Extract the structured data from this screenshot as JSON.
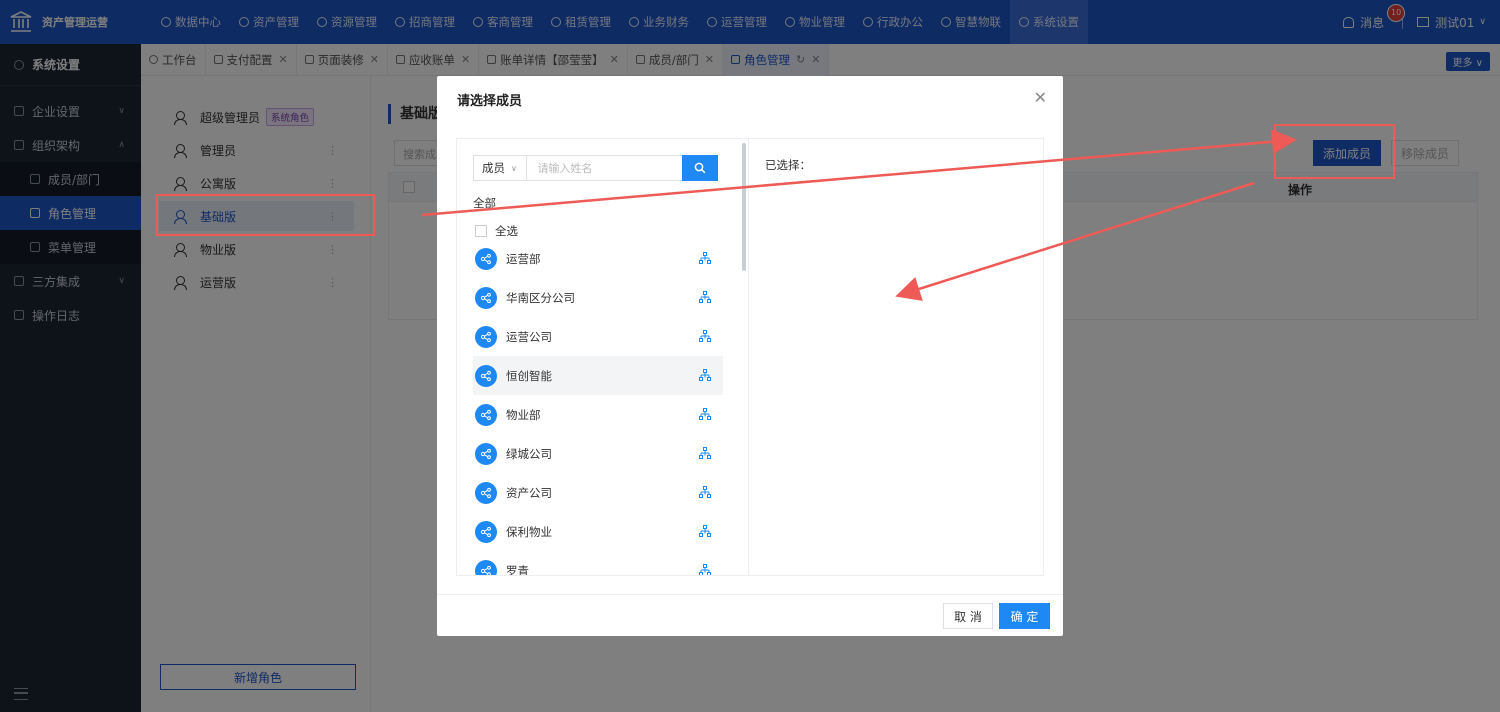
{
  "brand": {
    "name": "资产管理运营"
  },
  "nav": [
    {
      "label": "数据中心"
    },
    {
      "label": "资产管理"
    },
    {
      "label": "资源管理"
    },
    {
      "label": "招商管理"
    },
    {
      "label": "客商管理"
    },
    {
      "label": "租赁管理"
    },
    {
      "label": "业务财务"
    },
    {
      "label": "运营管理"
    },
    {
      "label": "物业管理"
    },
    {
      "label": "行政办公"
    },
    {
      "label": "智慧物联"
    },
    {
      "label": "系统设置"
    }
  ],
  "topright": {
    "messages_label": "消息",
    "messages_count": "10",
    "user": "测试01"
  },
  "sidebar": {
    "title": "系统设置",
    "items": [
      {
        "label": "企业设置"
      },
      {
        "label": "组织架构"
      },
      {
        "label": "成员/部门"
      },
      {
        "label": "角色管理"
      },
      {
        "label": "菜单管理"
      },
      {
        "label": "三方集成"
      },
      {
        "label": "操作日志"
      }
    ]
  },
  "tabs": [
    {
      "label": "工作台"
    },
    {
      "label": "支付配置"
    },
    {
      "label": "页面装修"
    },
    {
      "label": "应收账单"
    },
    {
      "label": "账单详情【邵莹莹】"
    },
    {
      "label": "成员/部门"
    },
    {
      "label": "角色管理"
    }
  ],
  "more_label": "更多",
  "roles": [
    {
      "label": "超级管理员",
      "tag": "系统角色"
    },
    {
      "label": "管理员"
    },
    {
      "label": "公寓版"
    },
    {
      "label": "基础版"
    },
    {
      "label": "物业版"
    },
    {
      "label": "运营版"
    }
  ],
  "add_role_label": "新增角色",
  "content": {
    "title": "基础版",
    "search_placeholder": "搜索成",
    "op_header": "操作",
    "add_member": "添加成员",
    "remove_member": "移除成员"
  },
  "modal": {
    "title": "请选择成员",
    "select_label": "成员",
    "search_placeholder": "请输入姓名",
    "all_label": "全部",
    "select_all": "全选",
    "departments": [
      {
        "label": "运营部"
      },
      {
        "label": "华南区分公司"
      },
      {
        "label": "运营公司"
      },
      {
        "label": "恒创智能"
      },
      {
        "label": "物业部"
      },
      {
        "label": "绿城公司"
      },
      {
        "label": "资产公司"
      },
      {
        "label": "保利物业"
      },
      {
        "label": "罗青"
      }
    ],
    "selected_label": "已选择：",
    "cancel": "取 消",
    "ok": "确 定"
  },
  "colors": {
    "primary": "#1f56c8",
    "accent": "#1e88f5",
    "annotation": "#ee5b57",
    "sidebar_bg": "#1c2433"
  }
}
